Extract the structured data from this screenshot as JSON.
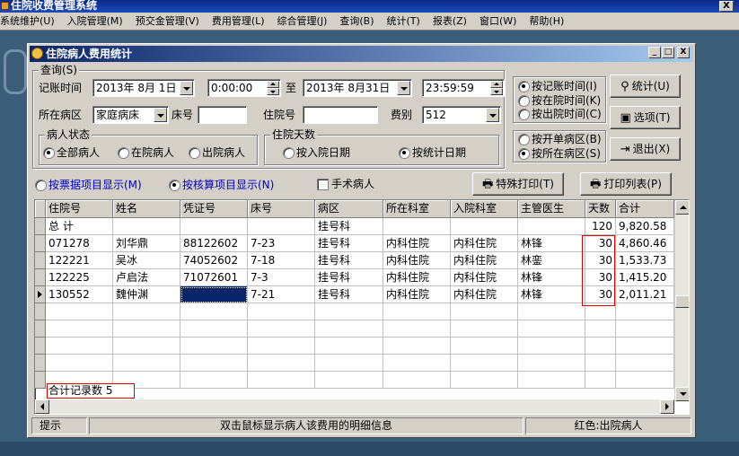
{
  "app": {
    "title": "住院收费管理系统",
    "close": "X"
  },
  "menu": [
    "系统维护(U)",
    "入院管理(M)",
    "预交金管理(V)",
    "费用管理(L)",
    "综合管理(J)",
    "查询(B)",
    "统计(T)",
    "报表(Z)",
    "窗口(W)",
    "帮助(H)"
  ],
  "window": {
    "title": "住院病人费用统计",
    "min": "_",
    "max": "□",
    "close": "X"
  },
  "query": {
    "group_title": "查询(S)",
    "time_label": "记账时间",
    "date_from": "2013年 8月 1日",
    "time_from": "0:00:00",
    "to_label": "至",
    "date_to": "2013年 8月31日",
    "time_to": "23:59:59",
    "ward_label": "所在病区",
    "ward_value": "家庭病床",
    "bed_label": "床号",
    "bed_value": "",
    "inpatient_no_label": "住院号",
    "inpatient_no_value": "",
    "fee_type_label": "费别",
    "fee_type_value": "512"
  },
  "time_mode": {
    "options": [
      "按记账时间(I)",
      "按在院时间(K)",
      "按出院时间(C)"
    ],
    "selected": 0
  },
  "ward_mode": {
    "options": [
      "按开单病区(B)",
      "按所在病区(S)"
    ],
    "selected": 1
  },
  "patient_status": {
    "title": "病人状态",
    "options": [
      "全部病人",
      "在院病人",
      "出院病人"
    ],
    "selected": 0
  },
  "days": {
    "title": "住院天数",
    "options": [
      "按入院日期",
      "按统计日期"
    ],
    "selected": 1
  },
  "buttons": {
    "stats": "统计(U)",
    "options": "选项(T)",
    "exit": "退出(X)",
    "special_print": "特殊打印(T)",
    "print_list": "打印列表(P)"
  },
  "display_mode": {
    "options": [
      "按票据项目显示(M)",
      "按核算项目显示(N)"
    ],
    "selected": 1
  },
  "surgery_checkbox": "手术病人",
  "table": {
    "columns": [
      "住院号",
      "姓名",
      "凭证号",
      "床号",
      "病区",
      "所在科室",
      "入院科室",
      "主管医生",
      "天数",
      "合计"
    ],
    "rows": [
      [
        "总 计",
        "",
        "",
        "",
        "挂号科",
        "",
        "",
        "",
        "120",
        "9,820.58"
      ],
      [
        "071278",
        "刘华鼎",
        "88122602",
        "7-23",
        "挂号科",
        "内科住院",
        "内科住院",
        "林锋",
        "30",
        "4,860.46"
      ],
      [
        "122221",
        "吴冰",
        "74052602",
        "7-18",
        "挂号科",
        "内科住院",
        "内科住院",
        "林銮",
        "30",
        "1,533.73"
      ],
      [
        "122225",
        "卢启法",
        "71072601",
        "7-3",
        "挂号科",
        "内科住院",
        "内科住院",
        "林锋",
        "30",
        "1,415.20"
      ],
      [
        "130552",
        "魏仲渊",
        "",
        "7-21",
        "挂号科",
        "内科住院",
        "内科住院",
        "林锋",
        "30",
        "2,011.21"
      ]
    ],
    "current_row": 4,
    "record_count_label": "合计记录数",
    "record_count": "5"
  },
  "statusbar": {
    "hint": "提示",
    "message": "双击鼠标显示病人该费用的明细信息",
    "legend": "红色:出院病人"
  },
  "colors": {
    "title_blue": "#0a246a",
    "radio_blue_text": "#0000c0",
    "highlight_cell": "#0a246a",
    "red_outline": "#e00000"
  }
}
